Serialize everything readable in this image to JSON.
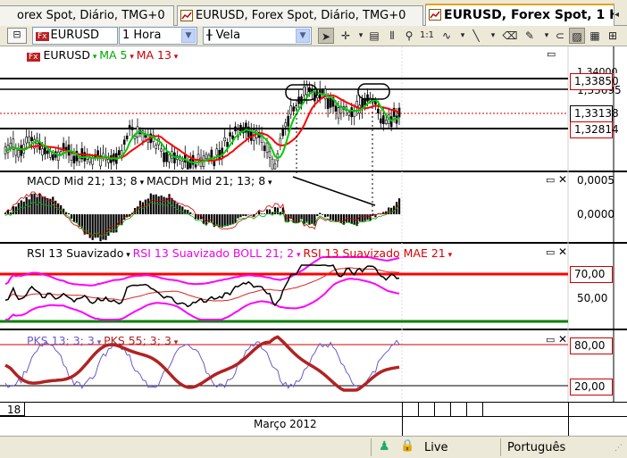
{
  "tabs": [
    {
      "label": "orex Spot, Diário, TMG+0",
      "active": false
    },
    {
      "label": "EURUSD, Forex Spot, Diário, TMG+0",
      "active": false
    },
    {
      "label": "EURUSD, Forex Spot, 1 H",
      "active": true
    }
  ],
  "toolbar": {
    "symbol": "EURUSD",
    "symbol_badge": "Fx",
    "timeframe": "1 Hora",
    "chart_type": "Vela"
  },
  "price_pane": {
    "symbol": "EURUSD",
    "symbol_badge": "Fx",
    "ma_fast": "MA 5",
    "ma_slow": "MA 13",
    "levels": {
      "top_partial": "1,34000",
      "resistance": "1,33850",
      "second": "1,33695",
      "current": "1,33138",
      "support": "1,32814"
    }
  },
  "macd_pane": {
    "label_macd": "MACD Mid  21; 13; 8",
    "label_macdh": "MACDH Mid  21; 13; 8",
    "scale_top": "0,0005",
    "scale_mid": "0,0000"
  },
  "rsi_pane": {
    "label_rsi": "RSI 13 Suavizado",
    "label_boll": "RSI 13 Suavizado BOLL 21; 2",
    "label_mae": "RSI 13 Suavizado MAE 21",
    "level_70": "70,00",
    "level_50": "50,00"
  },
  "pks_pane": {
    "label_pks13": "PKS 13; 3; 3",
    "label_pks55": "PKS 55; 3; 3",
    "level_80": "80,00",
    "level_20": "20,00"
  },
  "axis": {
    "day_label": "18",
    "month_label": "Março 2012"
  },
  "status": {
    "connection": "Live",
    "language": "Português"
  },
  "colors": {
    "candle_up": "#000000",
    "ma5": "#00cc00",
    "ma13": "#ff0000",
    "rsi_boll": "#ff00ff",
    "level_red": "#ff0000",
    "level_green": "#008000",
    "pks55": "#b22222",
    "pks13": "#6a5acd"
  }
}
